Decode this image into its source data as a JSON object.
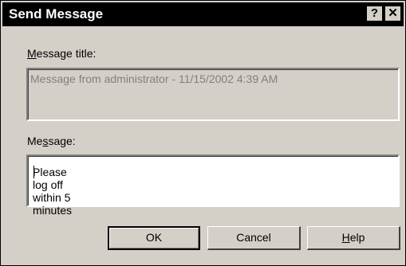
{
  "window": {
    "title": "Send Message",
    "help_glyph": "?",
    "close_glyph": "✕"
  },
  "message_title": {
    "label_prefix": "",
    "label_accel": "M",
    "label_rest": "essage title:",
    "value": "Message from administrator - 11/15/2002 4:39 AM"
  },
  "message": {
    "label_prefix": "Me",
    "label_accel": "s",
    "label_rest": "sage:",
    "value": "Please log off within 5 minutes"
  },
  "buttons": {
    "ok": "OK",
    "cancel": "Cancel",
    "help_accel": "H",
    "help_rest": "elp"
  }
}
